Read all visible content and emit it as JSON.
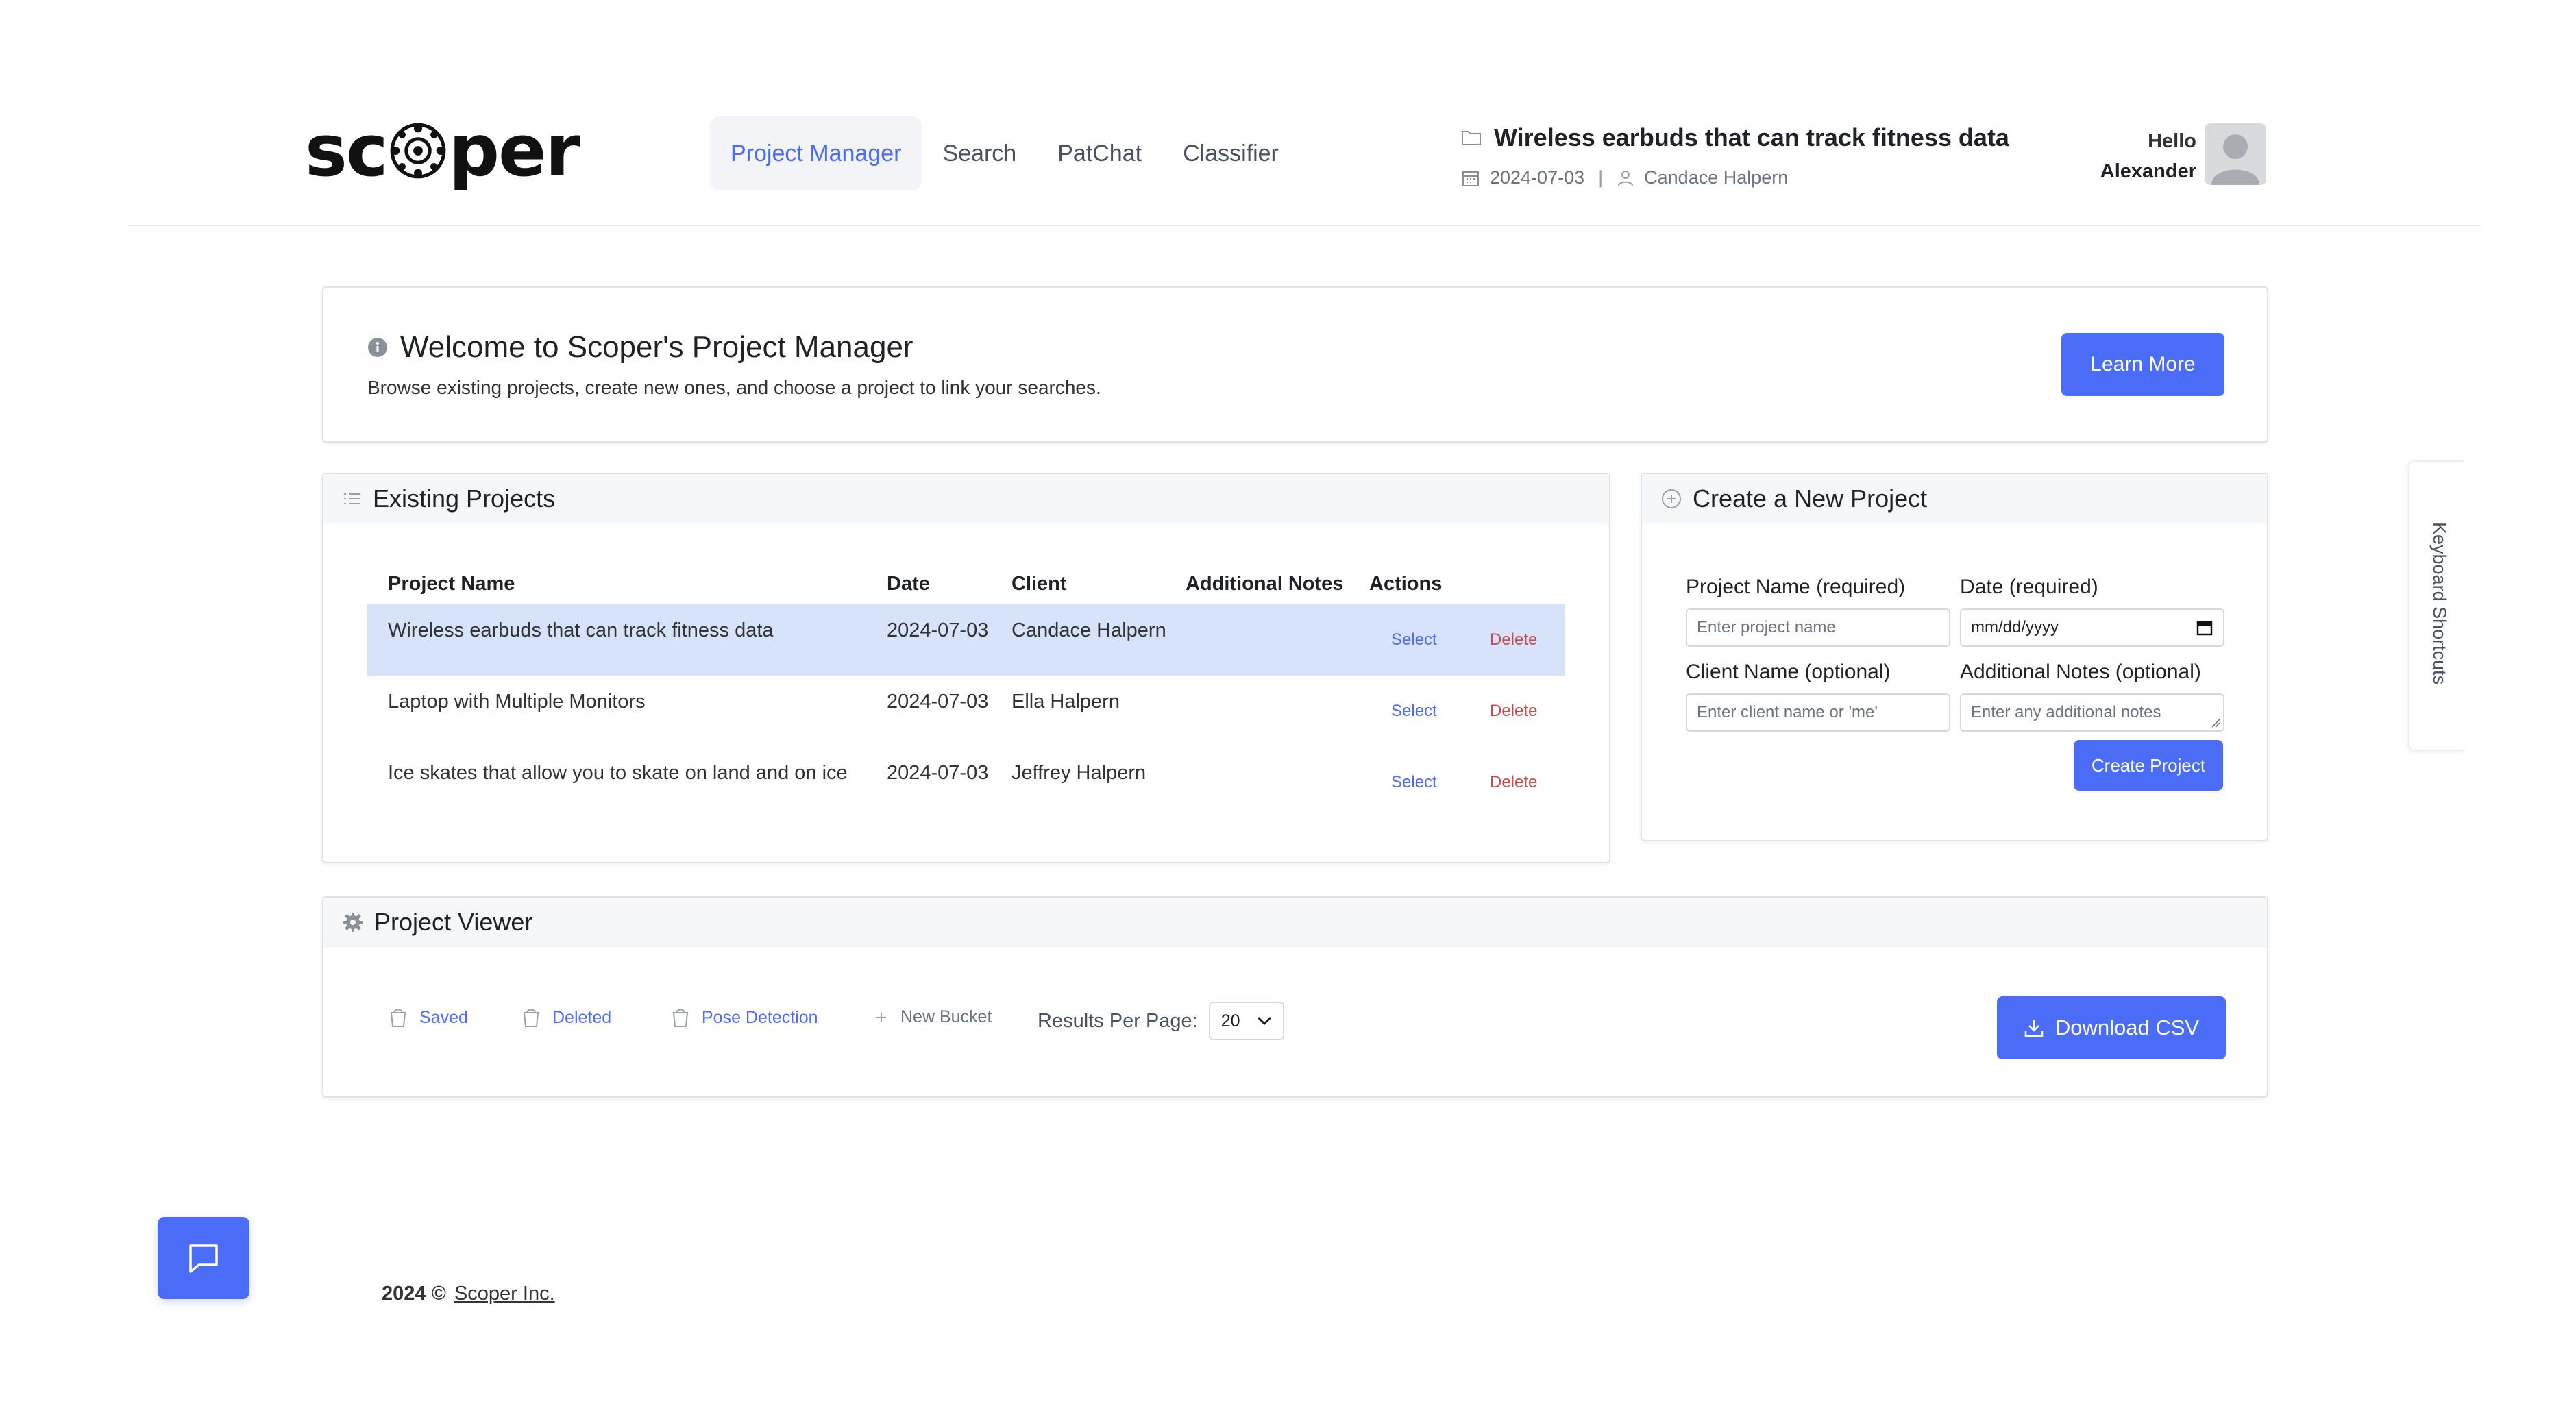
{
  "app": {
    "logo_text_left": "sc",
    "logo_text_right": "per"
  },
  "nav": {
    "items": [
      {
        "label": "Project Manager",
        "active": true
      },
      {
        "label": "Search",
        "active": false
      },
      {
        "label": "PatChat",
        "active": false
      },
      {
        "label": "Classifier",
        "active": false
      }
    ]
  },
  "current_project": {
    "title": "Wireless earbuds that can track fitness data",
    "date": "2024-07-03",
    "separator": "|",
    "client": "Candace Halpern"
  },
  "user": {
    "greeting": "Hello",
    "name": "Alexander"
  },
  "welcome": {
    "title": "Welcome to Scoper's Project Manager",
    "subtitle": "Browse existing projects, create new ones, and choose a project to link your searches.",
    "learn_more": "Learn More"
  },
  "existing_projects": {
    "heading": "Existing Projects",
    "columns": [
      "Project Name",
      "Date",
      "Client",
      "Additional Notes",
      "Actions"
    ],
    "rows": [
      {
        "name": "Wireless earbuds that can track fitness data",
        "date": "2024-07-03",
        "client": "Candace Halpern",
        "notes": "",
        "select": "Select",
        "delete": "Delete",
        "selected": true
      },
      {
        "name": "Laptop with Multiple Monitors",
        "date": "2024-07-03",
        "client": "Ella Halpern",
        "notes": "",
        "select": "Select",
        "delete": "Delete",
        "selected": false
      },
      {
        "name": "Ice skates that allow you to skate on land and on ice",
        "date": "2024-07-03",
        "client": "Jeffrey Halpern",
        "notes": "",
        "select": "Select",
        "delete": "Delete",
        "selected": false
      }
    ]
  },
  "create_project": {
    "heading": "Create a New Project",
    "project_name_label": "Project Name (required)",
    "project_name_placeholder": "Enter project name",
    "date_label": "Date (required)",
    "date_placeholder": "mm/dd/yyyy",
    "client_label": "Client Name (optional)",
    "client_placeholder": "Enter client name or 'me'",
    "notes_label": "Additional Notes (optional)",
    "notes_placeholder": "Enter any additional notes",
    "create_button": "Create Project"
  },
  "project_viewer": {
    "heading": "Project Viewer",
    "buckets": [
      {
        "label": "Saved"
      },
      {
        "label": "Deleted"
      },
      {
        "label": "Pose Detection"
      }
    ],
    "new_bucket": "New Bucket",
    "results_per_page_label": "Results Per Page:",
    "results_per_page_value": "20",
    "download_button": "Download CSV"
  },
  "keyboard_shortcuts": "Keyboard Shortcuts",
  "footer": {
    "year": "2024 ©",
    "company": "Scoper Inc."
  },
  "colors": {
    "accent": "#4a6cf7",
    "danger": "#c84a4a",
    "selected_row": "#d7e2fb"
  }
}
